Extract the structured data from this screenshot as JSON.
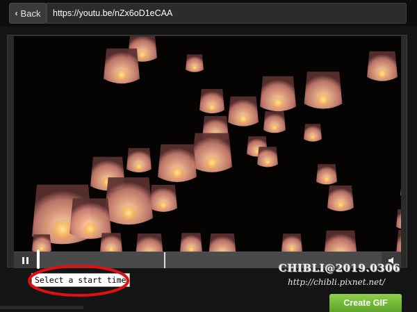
{
  "toolbar": {
    "back_label": "Back",
    "url_value": "https://youtu.be/nZx6oD1eCAA"
  },
  "player": {
    "video_description_icon": "sky-lanterns-video",
    "playback_state": "paused",
    "start_time_tooltip": "Select a start time"
  },
  "watermark": {
    "line1": "CHIBLI@2019.0306",
    "line2": "http://chibli.pixnet.net/"
  },
  "actions": {
    "create_gif_label": "Create GIF"
  },
  "colors": {
    "accent_green": "#7cc242",
    "annotation_red": "#e01010"
  }
}
